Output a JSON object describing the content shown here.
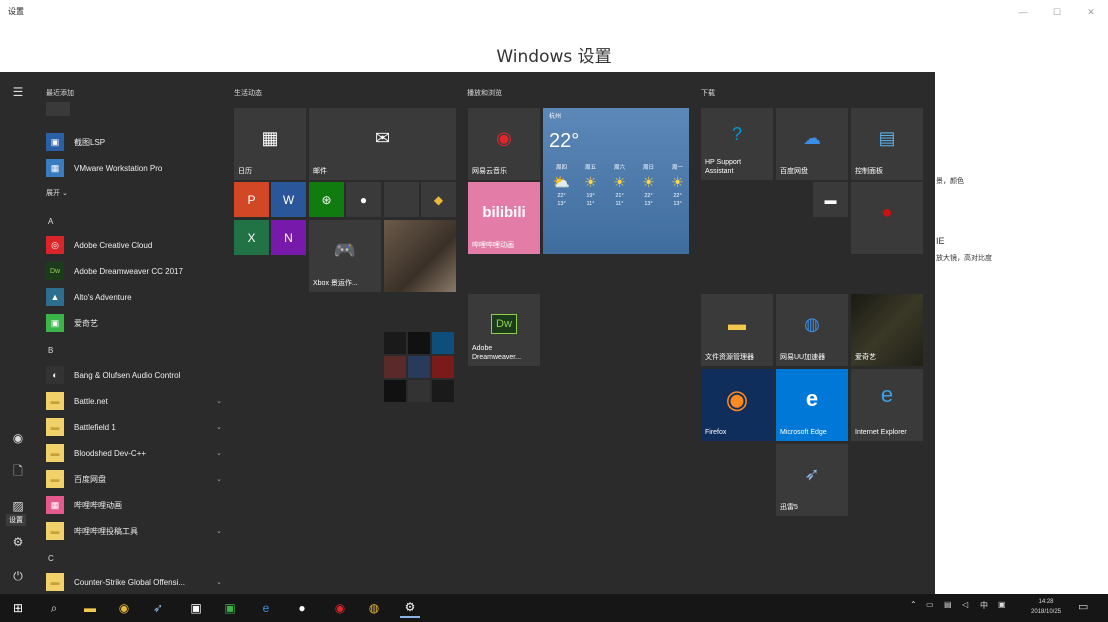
{
  "window": {
    "title": "设置",
    "heading": "Windows 设置",
    "peek1": "景，颜色",
    "peek2": "IE",
    "peek3": "放大镜，高对比度"
  },
  "rail": {
    "tooltip": "设置"
  },
  "applist": {
    "recent_header": "最近添加",
    "expand_label": "展开 ⌄",
    "items": [
      {
        "label": "截图LSP",
        "color": "#2b5fa8",
        "icon": "▣"
      },
      {
        "label": "VMware Workstation Pro",
        "color": "#3b7bbf",
        "icon": "▦"
      }
    ],
    "sections": [
      {
        "letter": "A",
        "items": [
          {
            "label": "Adobe Creative Cloud",
            "color": "#d9252a",
            "icon": "◎",
            "chevron": ""
          },
          {
            "label": "Adobe Dreamweaver CC 2017",
            "color": "#1b3b1b",
            "icon": "Dw",
            "chevron": ""
          },
          {
            "label": "Alto's Adventure",
            "color": "#2d6e8e",
            "icon": "▲",
            "chevron": ""
          },
          {
            "label": "爱奇艺",
            "color": "#3bb54a",
            "icon": "▣",
            "chevron": ""
          }
        ]
      },
      {
        "letter": "B",
        "items": [
          {
            "label": "Bang & Olufsen Audio Control",
            "color": "#333333",
            "icon": "◐",
            "chevron": ""
          },
          {
            "label": "Battle.net",
            "color": "#f2d16b",
            "icon": "▬",
            "chevron": "⌄"
          },
          {
            "label": "Battlefield 1",
            "color": "#f2d16b",
            "icon": "▬",
            "chevron": "⌄"
          },
          {
            "label": "Bloodshed Dev-C++",
            "color": "#f2d16b",
            "icon": "▬",
            "chevron": "⌄"
          },
          {
            "label": "百度网盘",
            "color": "#f2d16b",
            "icon": "▬",
            "chevron": "⌄"
          },
          {
            "label": "哔哩哔哩动画",
            "color": "#e45a8c",
            "icon": "▦",
            "chevron": ""
          },
          {
            "label": "哔哩哔哩投稿工具",
            "color": "#f2d16b",
            "icon": "▬",
            "chevron": "⌄"
          }
        ]
      },
      {
        "letter": "C",
        "items": [
          {
            "label": "Counter-Strike Global Offensi...",
            "color": "#f2d16b",
            "icon": "▬",
            "chevron": "⌄"
          }
        ]
      }
    ]
  },
  "groups": {
    "g1": "生活动态",
    "g2": "播放和浏览",
    "g3": "下载"
  },
  "tiles": {
    "calendar": "日历",
    "mail": "邮件",
    "xbox": "Xbox 景运作...",
    "netease": "网易云音乐",
    "bilibili": "哔哩哔哩动画",
    "bilibili_logo": "bilibili",
    "dreamweaver": "Adobe Dreamweaver...",
    "hp": "HP Support Assistant",
    "baidu": "百度网盘",
    "control": "控制面板",
    "explorer": "文件资源管理器",
    "netease_dl": "网易UU加速器",
    "photo": "爱奇艺",
    "firefox": "Firefox",
    "edge": "Microsoft Edge",
    "ie": "Internet Explorer",
    "wolf": "迅雷5"
  },
  "weather": {
    "city": "杭州",
    "temp": "22°",
    "days": [
      {
        "name": "周四",
        "hi": "22°",
        "lo": "13°"
      },
      {
        "name": "周五",
        "hi": "19°",
        "lo": "11°"
      },
      {
        "name": "周六",
        "hi": "21°",
        "lo": "11°"
      },
      {
        "name": "周日",
        "hi": "22°",
        "lo": "13°"
      },
      {
        "name": "周一",
        "hi": "22°",
        "lo": "13°"
      }
    ]
  },
  "taskbar": {
    "time": "14:28",
    "date": "2018/10/25",
    "ime": "中"
  }
}
